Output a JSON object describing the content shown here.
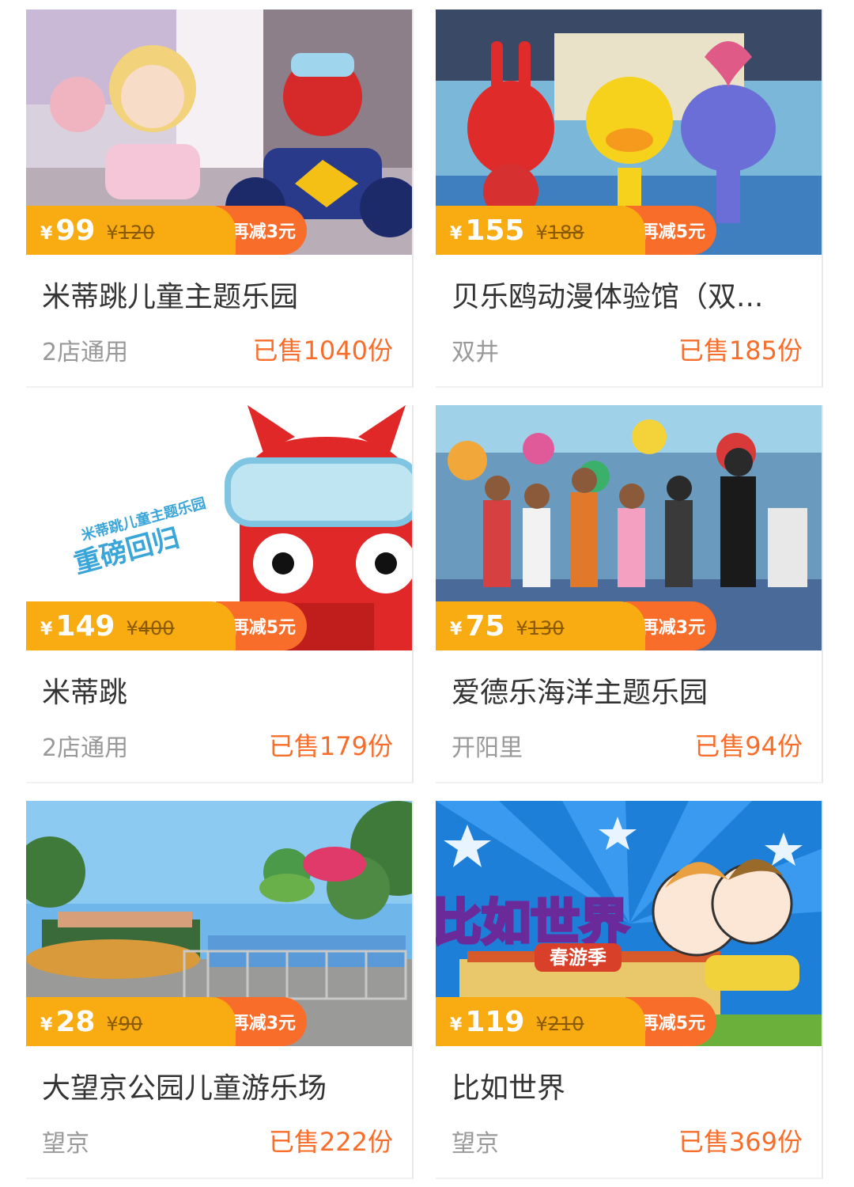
{
  "colors": {
    "price_bg": "#f8ac12",
    "discount_bg": "#f86d2a",
    "sold_text": "#f86d2a",
    "title_text": "#333333",
    "location_text": "#999999"
  },
  "currency_symbol": "¥",
  "products": [
    {
      "price": "99",
      "original_price": "120",
      "discount": "再减3元",
      "title": "米蒂跳儿童主题乐园",
      "location": "2店通用",
      "sold": "已售1040份",
      "image": "indoor-playground-cartoon-statues-photo"
    },
    {
      "price": "155",
      "original_price": "188",
      "discount": "再减5元",
      "title": "贝乐鸥动漫体验馆（双...",
      "location": "双井",
      "sold": "已售185份",
      "image": "cartoon-character-statues-photo"
    },
    {
      "price": "149",
      "original_price": "400",
      "discount": "再减5元",
      "title": "米蒂跳",
      "location": "2店通用",
      "sold": "已售179份",
      "image": "red-monster-mascot-illustration",
      "image_text": [
        "米蒂跳儿童主题乐园",
        "重磅回归"
      ]
    },
    {
      "price": "75",
      "original_price": "130",
      "discount": "再减3元",
      "title": "爱德乐海洋主题乐园",
      "location": "开阳里",
      "sold": "已售94份",
      "image": "children-group-playground-photo"
    },
    {
      "price": "28",
      "original_price": "90",
      "discount": "再减3元",
      "title": "大望京公园儿童游乐场",
      "location": "望京",
      "sold": "已售222份",
      "image": "outdoor-amusement-park-photo"
    },
    {
      "price": "119",
      "original_price": "210",
      "discount": "再减5元",
      "title": "比如世界",
      "location": "望京",
      "sold": "已售369份",
      "image": "cartoon-kids-flying-poster",
      "image_text": [
        "比如世界",
        "春游季"
      ]
    }
  ]
}
